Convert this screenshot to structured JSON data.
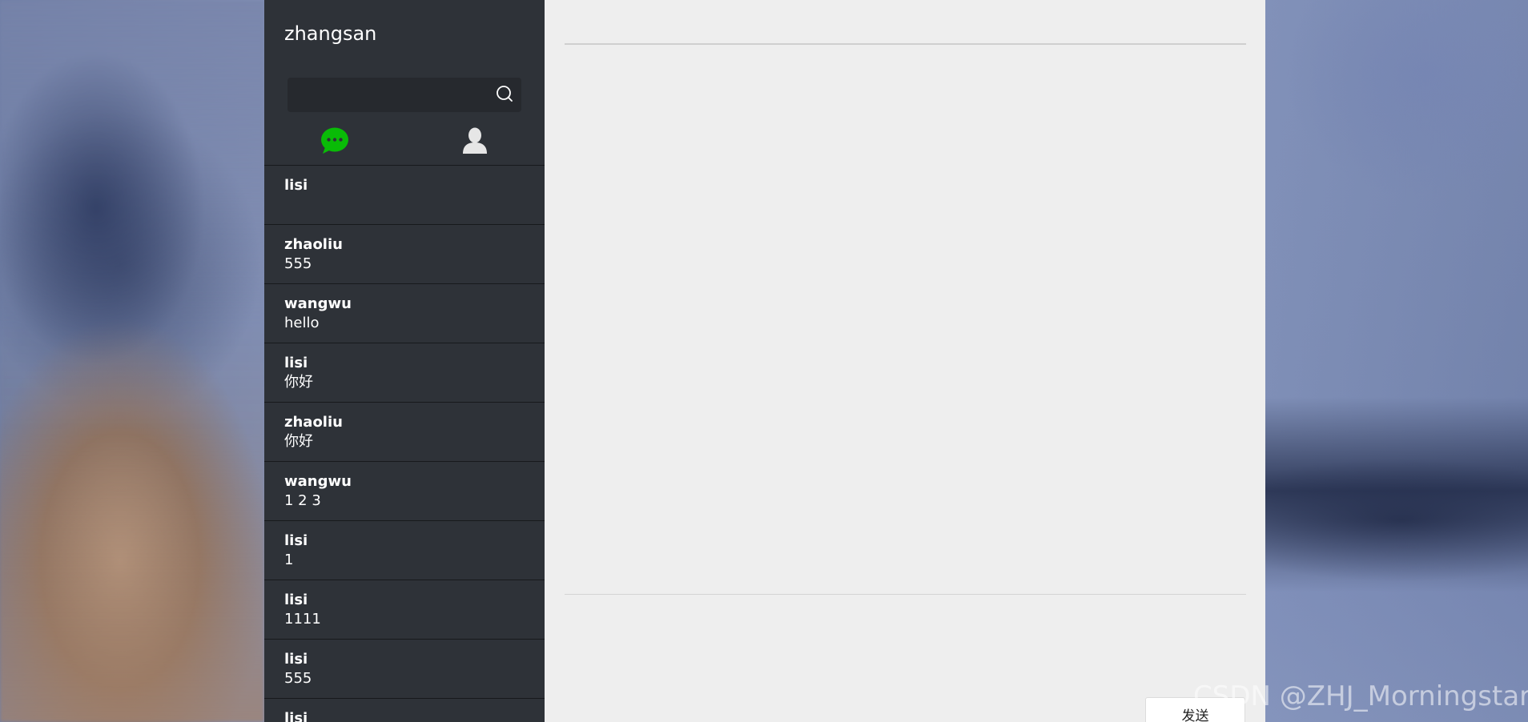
{
  "sidebar": {
    "user_name": "zhangsan",
    "search": {
      "value": "",
      "placeholder": ""
    },
    "tabs": [
      {
        "id": "chat",
        "icon": "chat-bubble-icon",
        "color": "#09bb07"
      },
      {
        "id": "contacts",
        "icon": "person-icon",
        "color": "#e6e6e6"
      }
    ],
    "sessions": [
      {
        "name": "lisi",
        "last_message": ""
      },
      {
        "name": "zhaoliu",
        "last_message": "555"
      },
      {
        "name": "wangwu",
        "last_message": "hello"
      },
      {
        "name": "lisi",
        "last_message": "你好"
      },
      {
        "name": "zhaoliu",
        "last_message": "你好"
      },
      {
        "name": "wangwu",
        "last_message": "1 2 3"
      },
      {
        "name": "lisi",
        "last_message": "1"
      },
      {
        "name": "lisi",
        "last_message": "1111"
      },
      {
        "name": "lisi",
        "last_message": "555"
      },
      {
        "name": "lisi",
        "last_message": ""
      }
    ]
  },
  "chat": {
    "title": "",
    "input_value": "",
    "send_label": "发送"
  },
  "watermark": "CSDN @ZHJ_Morningstar",
  "colors": {
    "sidebar_bg": "#2e3238",
    "search_bg": "#26292e",
    "chat_bg": "#eeeeee",
    "accent_green": "#09bb07"
  }
}
